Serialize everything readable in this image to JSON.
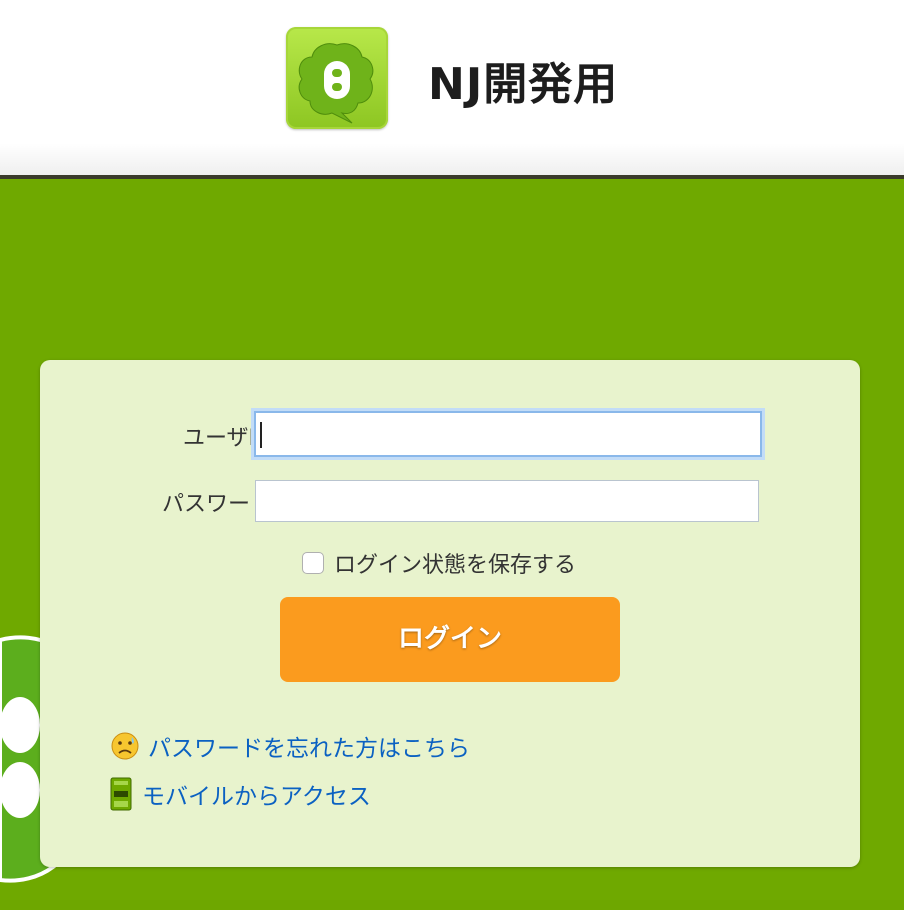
{
  "header": {
    "title": "NJ開発用",
    "logo_icon": "speech-bubble-logo-icon"
  },
  "login_form": {
    "user_id_label": "ユーザID",
    "user_id_value": "",
    "password_label": "パスワード",
    "password_value": "",
    "remember_label": "ログイン状態を保存する",
    "remember_checked": false,
    "login_button": "ログイン"
  },
  "links": {
    "forgot_password": "パスワードを忘れた方はこちら",
    "forgot_password_icon": "worried-face-icon",
    "mobile_access": "モバイルからアクセス",
    "mobile_access_icon": "mobile-phone-icon"
  },
  "colors": {
    "background_green": "#6fa900",
    "panel": "#e8f3cd",
    "button_orange": "#fb9b1e",
    "link_blue": "#0b61c2"
  }
}
